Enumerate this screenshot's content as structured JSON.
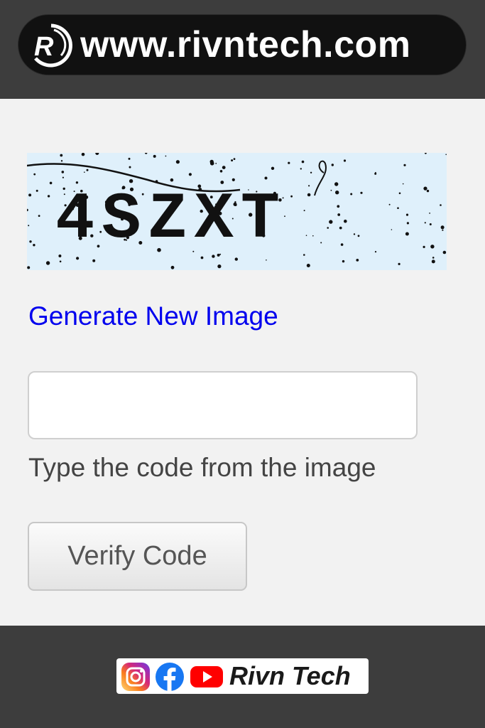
{
  "header": {
    "url": "www.rivntech.com",
    "logo_icon": "rivn-logo-icon",
    "logo_letter": "R"
  },
  "captcha": {
    "code": "4SZXT",
    "icon": "captcha-image",
    "background_color": "#dff0fb"
  },
  "links": {
    "generate": "Generate New Image"
  },
  "form": {
    "code_input_value": "",
    "code_input_placeholder": "",
    "hint": "Type the code from the image",
    "verify_label": "Verify Code"
  },
  "footer": {
    "icons": [
      "instagram-icon",
      "facebook-icon",
      "youtube-icon"
    ],
    "name": "Rivn Tech"
  },
  "colors": {
    "link": "#0000ee",
    "band": "#3d3d3d",
    "page_bg": "#f2f2f2"
  }
}
